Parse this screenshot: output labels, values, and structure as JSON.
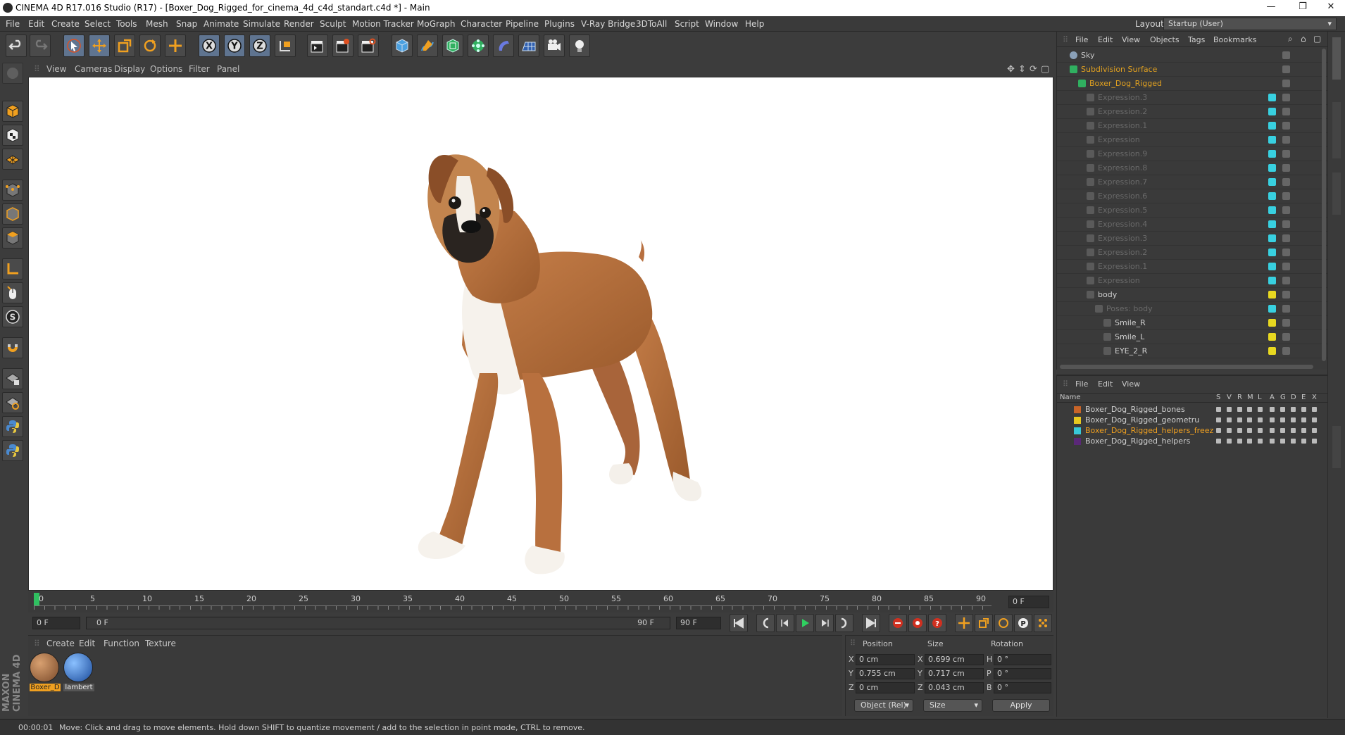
{
  "window": {
    "title": "CINEMA 4D R17.016 Studio (R17) - [Boxer_Dog_Rigged_for_cinema_4d_c4d_standart.c4d *] - Main",
    "minimize": "—",
    "restore": "❐",
    "close": "✕"
  },
  "menu": [
    "File",
    "Edit",
    "Create",
    "Select",
    "Tools",
    "Mesh",
    "Snap",
    "Animate",
    "Simulate",
    "Render",
    "Sculpt",
    "Motion Tracker",
    "MoGraph",
    "Character",
    "Pipeline",
    "Plugins",
    "V-Ray Bridge",
    "3DToAll",
    "Script",
    "Window",
    "Help"
  ],
  "layout": {
    "label": "Layout:",
    "value": "Startup (User)"
  },
  "viewport_menu": [
    "View",
    "Cameras",
    "Display",
    "Options",
    "Filter",
    "Panel"
  ],
  "timeline": {
    "ticks": [
      "0",
      "5",
      "10",
      "15",
      "20",
      "25",
      "30",
      "35",
      "40",
      "45",
      "50",
      "55",
      "60",
      "65",
      "70",
      "75",
      "80",
      "85",
      "90"
    ],
    "current_frame": "0 F"
  },
  "playback": {
    "start": "0 F",
    "slider_start": "0 F",
    "slider_end": "90 F",
    "end": "90 F"
  },
  "material_manager": {
    "menu": [
      "Create",
      "Edit",
      "Function",
      "Texture"
    ],
    "materials": [
      {
        "name": "Boxer_D",
        "selected": true
      },
      {
        "name": "lambert",
        "selected": false
      }
    ]
  },
  "coordinates": {
    "headers": {
      "position": "Position",
      "size": "Size",
      "rotation": "Rotation"
    },
    "rows": [
      {
        "axis": "X",
        "pos": "0 cm",
        "size_axis": "X",
        "size": "0.699 cm",
        "rot_axis": "H",
        "rot": "0 °"
      },
      {
        "axis": "Y",
        "pos": "0.755 cm",
        "size_axis": "Y",
        "size": "0.717 cm",
        "rot_axis": "P",
        "rot": "0 °"
      },
      {
        "axis": "Z",
        "pos": "0 cm",
        "size_axis": "Z",
        "size": "0.043 cm",
        "rot_axis": "B",
        "rot": "0 °"
      }
    ],
    "mode": "Object (Rel)",
    "size_mode": "Size",
    "apply": "Apply"
  },
  "status": {
    "time": "00:00:01",
    "message": "Move: Click and drag to move elements. Hold down SHIFT to quantize movement / add to the selection in point mode, CTRL to remove."
  },
  "object_manager": {
    "menu": [
      "File",
      "Edit",
      "View",
      "Objects",
      "Tags",
      "Bookmarks"
    ],
    "objects": [
      {
        "name": "Sky",
        "indent": 0,
        "color": "#c8c8c8",
        "tag": ""
      },
      {
        "name": "Subdivision Surface",
        "indent": 0,
        "color": "#e0a020",
        "tag": ""
      },
      {
        "name": "Boxer_Dog_Rigged",
        "indent": 1,
        "color": "#e0a020",
        "tag": ""
      },
      {
        "name": "Expression.3",
        "indent": 2,
        "color": "#6a6a6a",
        "tag": "#38d0e0"
      },
      {
        "name": "Expression.2",
        "indent": 2,
        "color": "#6a6a6a",
        "tag": "#38d0e0"
      },
      {
        "name": "Expression.1",
        "indent": 2,
        "color": "#6a6a6a",
        "tag": "#38d0e0"
      },
      {
        "name": "Expression",
        "indent": 2,
        "color": "#6a6a6a",
        "tag": "#38d0e0"
      },
      {
        "name": "Expression.9",
        "indent": 2,
        "color": "#6a6a6a",
        "tag": "#38d0e0"
      },
      {
        "name": "Expression.8",
        "indent": 2,
        "color": "#6a6a6a",
        "tag": "#38d0e0"
      },
      {
        "name": "Expression.7",
        "indent": 2,
        "color": "#6a6a6a",
        "tag": "#38d0e0"
      },
      {
        "name": "Expression.6",
        "indent": 2,
        "color": "#6a6a6a",
        "tag": "#38d0e0"
      },
      {
        "name": "Expression.5",
        "indent": 2,
        "color": "#6a6a6a",
        "tag": "#38d0e0"
      },
      {
        "name": "Expression.4",
        "indent": 2,
        "color": "#6a6a6a",
        "tag": "#38d0e0"
      },
      {
        "name": "Expression.3",
        "indent": 2,
        "color": "#6a6a6a",
        "tag": "#38d0e0"
      },
      {
        "name": "Expression.2",
        "indent": 2,
        "color": "#6a6a6a",
        "tag": "#38d0e0"
      },
      {
        "name": "Expression.1",
        "indent": 2,
        "color": "#6a6a6a",
        "tag": "#38d0e0"
      },
      {
        "name": "Expression",
        "indent": 2,
        "color": "#6a6a6a",
        "tag": "#38d0e0"
      },
      {
        "name": "body",
        "indent": 2,
        "color": "#d0d0d0",
        "tag": "#e8d820"
      },
      {
        "name": "Poses: body",
        "indent": 3,
        "color": "#6a6a6a",
        "tag": "#38d0e0"
      },
      {
        "name": "Smile_R",
        "indent": 4,
        "color": "#d0d0d0",
        "tag": "#e8d820"
      },
      {
        "name": "Smile_L",
        "indent": 4,
        "color": "#d0d0d0",
        "tag": "#e8d820"
      },
      {
        "name": "EYE_2_R",
        "indent": 4,
        "color": "#d0d0d0",
        "tag": "#e8d820"
      }
    ]
  },
  "layer_manager": {
    "menu": [
      "File",
      "Edit",
      "View"
    ],
    "columns": [
      "Name",
      "S",
      "V",
      "R",
      "M",
      "L",
      "A",
      "G",
      "D",
      "E",
      "X"
    ],
    "layers": [
      {
        "name": "Boxer_Dog_Rigged_bones",
        "color": "#c86428",
        "selected": false
      },
      {
        "name": "Boxer_Dog_Rigged_geometru",
        "color": "#e8c820",
        "selected": false
      },
      {
        "name": "Boxer_Dog_Rigged_helpers_freez",
        "color": "#38c8d8",
        "selected": true
      },
      {
        "name": "Boxer_Dog_Rigged_helpers",
        "color": "#5a2878",
        "selected": false
      }
    ]
  },
  "brand": "MAXON CINEMA 4D",
  "colors": {
    "accent_orange": "#e0a020",
    "selection_blue": "#5f7490",
    "viewport_bg": "#ffffff"
  }
}
